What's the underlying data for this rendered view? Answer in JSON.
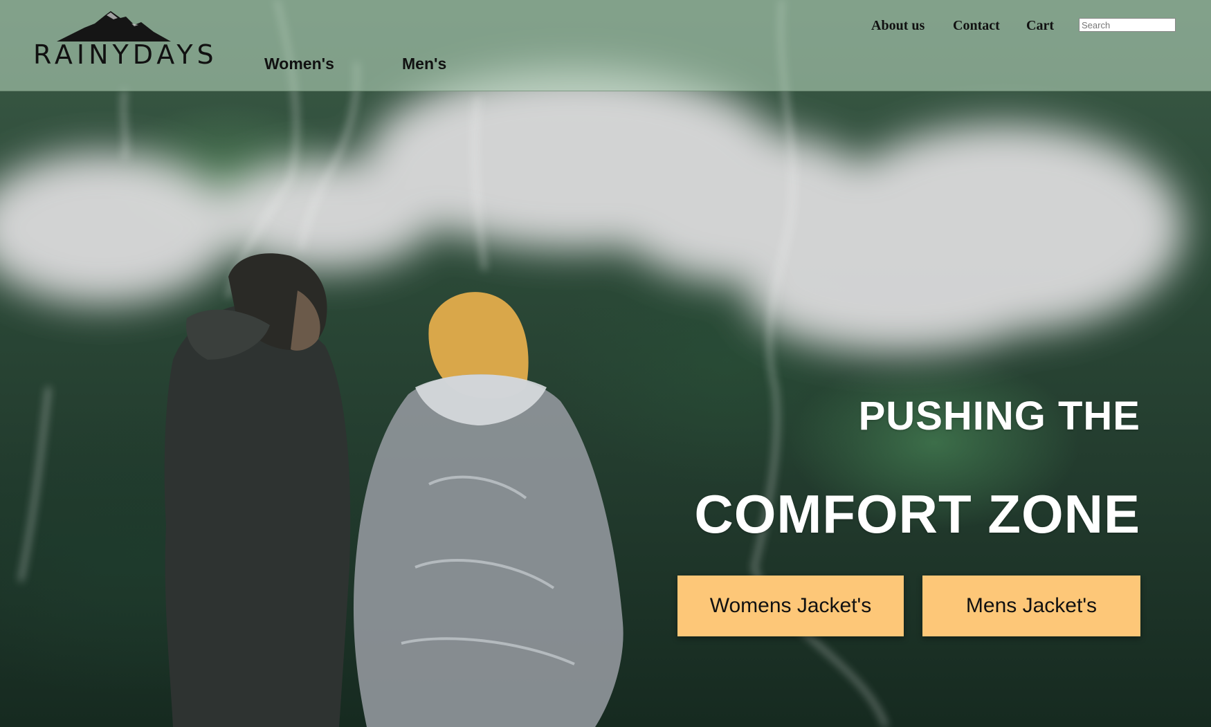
{
  "brand": {
    "name": "RAINYDAYS",
    "logo_icon": "mountain-icon"
  },
  "main_nav": {
    "women": "Women's",
    "men": "Men's"
  },
  "utility_nav": {
    "about": "About us",
    "contact": "Contact",
    "cart": "Cart"
  },
  "search": {
    "placeholder": "Search",
    "value": ""
  },
  "hero": {
    "headline_line1": "PUSHING THE",
    "headline_line2": "COMFORT ZONE",
    "buttons": {
      "womens": "Womens Jacket's",
      "mens": "Mens Jacket's"
    }
  },
  "colors": {
    "header_overlay": "#afcdb4",
    "button_bg": "#fdc778",
    "headline_text": "#ffffff"
  }
}
